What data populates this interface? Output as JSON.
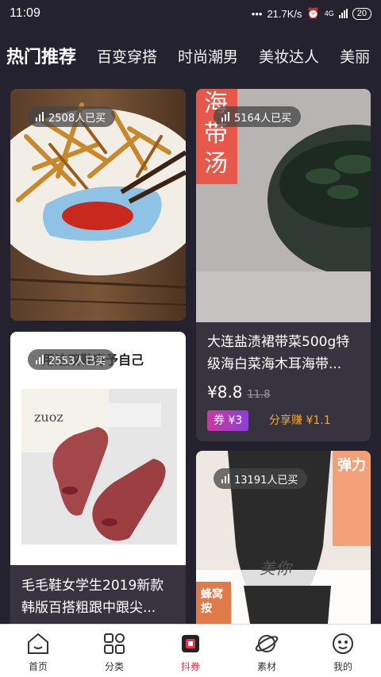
{
  "status_bar": {
    "time": "11:09",
    "network_speed": "21.7K/s",
    "signal_label": "4G",
    "battery": "20"
  },
  "tabs": [
    {
      "label": "热门推荐",
      "active": true
    },
    {
      "label": "百变穿搭"
    },
    {
      "label": "时尚潮男"
    },
    {
      "label": "美妆达人"
    },
    {
      "label": "美丽"
    }
  ],
  "products": [
    {
      "sold": "2508人已买"
    },
    {
      "sold": "5164人已买",
      "title": "大连盐渍裙带菜500g特级海白菜海木耳海带...",
      "price": "¥8.8",
      "original_price": "11.8",
      "coupon": "券 ¥3",
      "share": "分享赚 ¥1.1",
      "image_caption": "海带汤"
    },
    {
      "sold": "2553人已买",
      "title": "毛毛鞋女学生2019新款韩版百搭粗跟中跟尖...",
      "image_caption": "用这双鞋寄予自己",
      "shoebox_text": "zuoz"
    },
    {
      "sold": "13191人已买",
      "image_caption_top": "弹力",
      "image_caption_mid": "美你",
      "image_caption_side": "蜂窝按"
    }
  ],
  "bottom_nav": [
    {
      "label": "首页",
      "icon": "home-icon"
    },
    {
      "label": "分类",
      "icon": "category-icon"
    },
    {
      "label": "抖券",
      "icon": "douquan-icon",
      "active": true
    },
    {
      "label": "素材",
      "icon": "planet-icon"
    },
    {
      "label": "我的",
      "icon": "smiley-icon"
    }
  ],
  "colors": {
    "background": "#24222f",
    "card": "#37343f",
    "accent": "#e8324f",
    "share": "#f0a830"
  }
}
